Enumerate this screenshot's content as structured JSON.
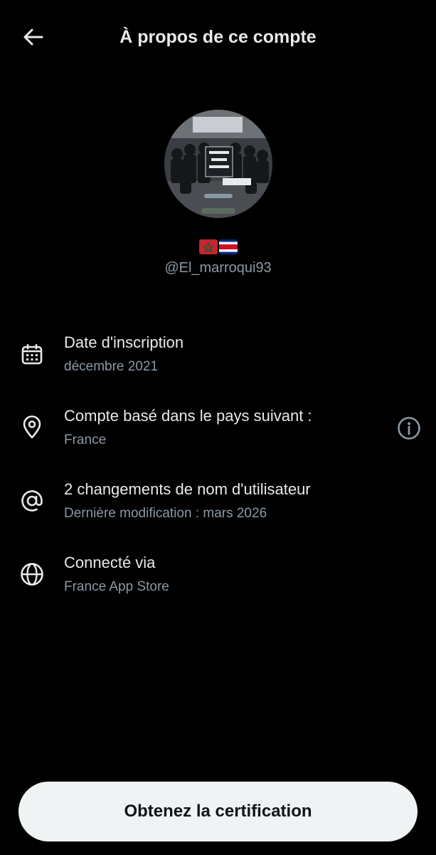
{
  "header": {
    "title": "À propos de ce compte",
    "back_icon": "arrow-left-icon"
  },
  "profile": {
    "avatar_description_icon": "profile-photo",
    "flags": [
      "morocco-flag",
      "costa-rica-flag"
    ],
    "handle": "@El_marroqui93"
  },
  "info": [
    {
      "icon": "calendar-icon",
      "label": "Date d'inscription",
      "value": "décembre 2021"
    },
    {
      "icon": "location-pin-icon",
      "label": "Compte basé dans le pays suivant :",
      "value": "France",
      "trailing_icon": "info-icon"
    },
    {
      "icon": "at-sign-icon",
      "label": "2 changements de nom d'utilisateur",
      "value": "Dernière modification : mars 2026"
    },
    {
      "icon": "globe-icon",
      "label": "Connecté via",
      "value": "France App Store"
    }
  ],
  "cta": {
    "label": "Obtenez la certification"
  },
  "colors": {
    "background": "#000000",
    "primary_text": "#e7e9ea",
    "secondary_text": "#8b98a5",
    "button_bg": "#eff3f4",
    "button_text": "#0f1419"
  }
}
